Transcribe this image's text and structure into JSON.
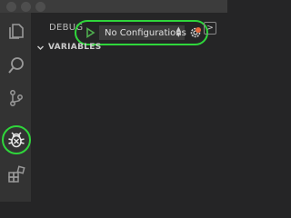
{
  "debug_panel": {
    "title": "DEBUG",
    "configuration": "No Configurations",
    "console_glyph": ">",
    "section_chevron": "⌄",
    "variables_label": "VARIABLES"
  },
  "activity_bar": {
    "items": [
      "explorer-icon",
      "search-icon",
      "source-control-icon",
      "debug-icon",
      "extensions-icon"
    ]
  },
  "colors": {
    "highlight_ring": "#2fd63b",
    "gear_badge": "#e5663a",
    "run_button": "#4fae4f"
  }
}
